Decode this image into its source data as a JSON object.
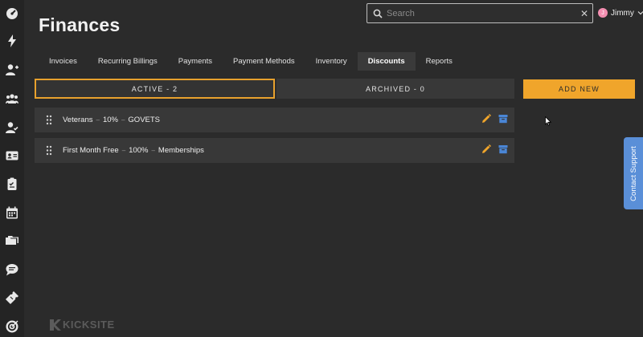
{
  "page": {
    "title": "Finances"
  },
  "search": {
    "placeholder": "Search"
  },
  "user": {
    "initial": "J",
    "name": "Jimmy"
  },
  "sidebar": {
    "icons": [
      "dashboard-icon",
      "lightning-icon",
      "add-user-icon",
      "group-icon",
      "user-check-icon",
      "id-card-icon",
      "clipboard-icon",
      "calendar-icon",
      "folders-icon",
      "chat-icon",
      "ticket-icon",
      "target-icon"
    ]
  },
  "tabs": [
    {
      "label": "Invoices"
    },
    {
      "label": "Recurring Billings"
    },
    {
      "label": "Payments"
    },
    {
      "label": "Payment Methods"
    },
    {
      "label": "Inventory"
    },
    {
      "label": "Discounts",
      "active": true
    },
    {
      "label": "Reports"
    }
  ],
  "segments": {
    "active": "ACTIVE - 2",
    "archived": "ARCHIVED - 0"
  },
  "add_new": "ADD NEW",
  "discounts": [
    {
      "name": "Veterans",
      "amount": "10%",
      "code": "GOVETS"
    },
    {
      "name": "First Month Free",
      "amount": "100%",
      "code": "Memberships"
    }
  ],
  "separator": "–",
  "contact_support": "Contact Support",
  "brand": "KICKSITE",
  "colors": {
    "accent": "#f0a52b",
    "edit": "#f0a52b",
    "archive": "#4a86d6",
    "support": "#5a8fd8"
  }
}
